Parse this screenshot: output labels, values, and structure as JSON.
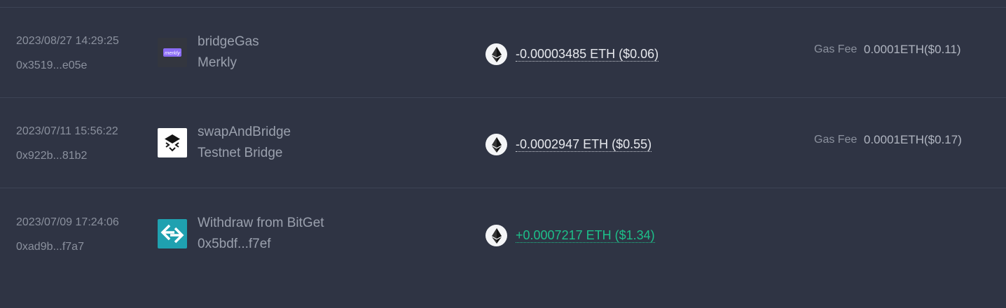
{
  "transactions": [
    {
      "date": "2023/08/27 14:29:25",
      "hash": "0x3519...e05e",
      "logo": "merkly-logo",
      "logo_text": "merkly",
      "method": "bridgeGas",
      "counterparty": "Merkly",
      "amount": "-0.00003485 ETH ($0.06)",
      "direction": "out",
      "fee_label": "Gas Fee",
      "fee_value": "0.0001ETH($0.11)"
    },
    {
      "date": "2023/07/11 15:56:22",
      "hash": "0x922b...81b2",
      "logo": "testnet-bridge-logo",
      "method": "swapAndBridge",
      "counterparty": "Testnet Bridge",
      "amount": "-0.0002947 ETH ($0.55)",
      "direction": "out",
      "fee_label": "Gas Fee",
      "fee_value": "0.0001ETH($0.17)"
    },
    {
      "date": "2023/07/09 17:24:06",
      "hash": "0xad9b...f7a7",
      "logo": "bitget-logo",
      "method": "Withdraw from BitGet",
      "counterparty": "0x5bdf...f7ef",
      "amount": "+0.0007217 ETH ($1.34)",
      "direction": "in"
    }
  ],
  "colors": {
    "background": "#2f3444",
    "positive": "#1dc08a",
    "merkly_accent": "#8b6cf6",
    "bitget_accent": "#1fa1b0"
  },
  "icons": {
    "token": "ethereum-icon"
  }
}
